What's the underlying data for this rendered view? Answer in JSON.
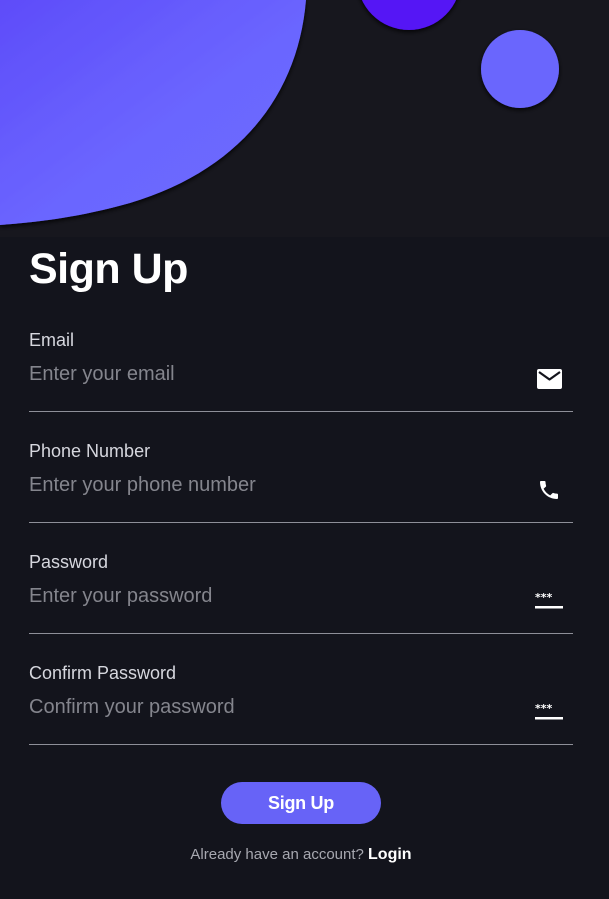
{
  "title": "Sign Up",
  "fields": [
    {
      "label": "Email",
      "placeholder": "Enter your email",
      "value": "",
      "icon": "mail-icon"
    },
    {
      "label": "Phone Number",
      "placeholder": "Enter your phone number",
      "value": "",
      "icon": "phone-icon"
    },
    {
      "label": "Password",
      "placeholder": "Enter your password",
      "value": "",
      "icon": "password-icon"
    },
    {
      "label": "Confirm Password",
      "placeholder": "Confirm your password",
      "value": "",
      "icon": "password-icon"
    }
  ],
  "button": {
    "label": "Sign Up"
  },
  "footer": {
    "prompt": "Already have an account?",
    "link": "Login"
  },
  "colors": {
    "background": "#13141c",
    "accent": "#6763f7",
    "blob": "#6b66ff",
    "circle_dark": "#5512f5"
  }
}
